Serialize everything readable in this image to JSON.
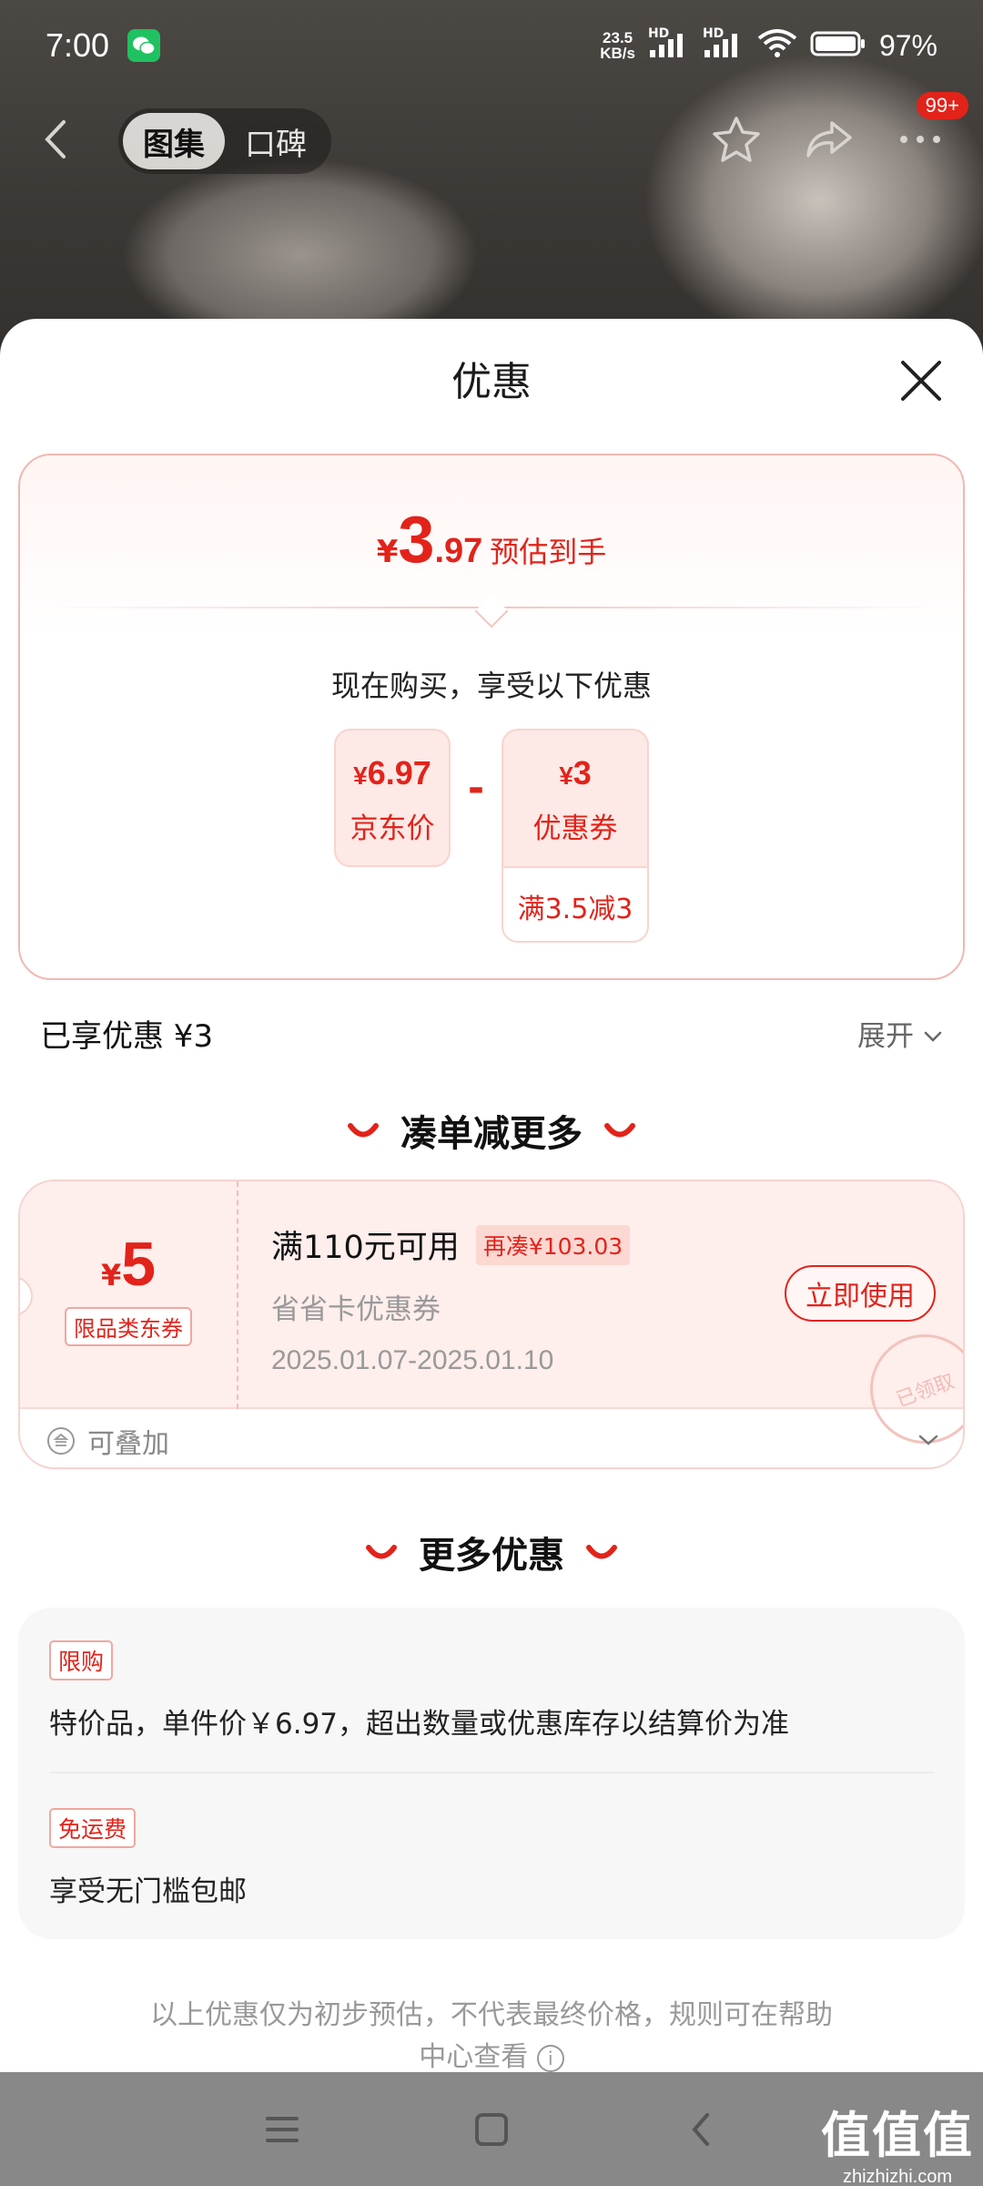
{
  "status_bar": {
    "time": "7:00",
    "net_speed_value": "23.5",
    "net_speed_unit": "KB/s",
    "hd1": "HD",
    "hd2": "HD",
    "battery": "97%"
  },
  "nav": {
    "tabs": [
      "图集",
      "口碑"
    ],
    "active_tab": 0,
    "badge": "99+"
  },
  "sheet": {
    "title": "优惠",
    "estimate": {
      "currency": "¥",
      "integer": "3",
      "decimal": ".97",
      "label": "预估到手"
    },
    "now_buy_text": "现在购买，享受以下优惠",
    "jd_price": {
      "currency": "¥",
      "value": "6.97",
      "label": "京东价"
    },
    "minus": "-",
    "coupon_price": {
      "currency": "¥",
      "value": "3",
      "label": "优惠券",
      "condition": "满3.5减3"
    },
    "enjoyed_text": "已享优惠 ¥3",
    "expand_label": "展开"
  },
  "section_more_deals": "凑单减更多",
  "coupon": {
    "currency": "¥",
    "amount": "5",
    "type_tag": "限品类东券",
    "condition": "满110元可用",
    "add_more": "再凑¥103.03",
    "kind": "省省卡优惠券",
    "date_range": "2025.01.07-2025.01.10",
    "use_button": "立即使用",
    "stamp": "已领取",
    "stackable": "可叠加"
  },
  "section_more_offers": "更多优惠",
  "more_offers": [
    {
      "tag": "限购",
      "text": "特价品，单件价￥6.97，超出数量或优惠库存以结算价为准"
    },
    {
      "tag": "免运费",
      "text": "享受无门槛包邮"
    }
  ],
  "disclaimer_line1": "以上优惠仅为初步预估，不代表最终价格，规则可在帮助",
  "disclaimer_line2": "中心查看",
  "watermark": {
    "big": "值值值",
    "small": "zhizhizhi.com"
  },
  "colors": {
    "accent": "#e2231a",
    "coupon_bg": "#feeeec",
    "wechat": "#20c160"
  }
}
